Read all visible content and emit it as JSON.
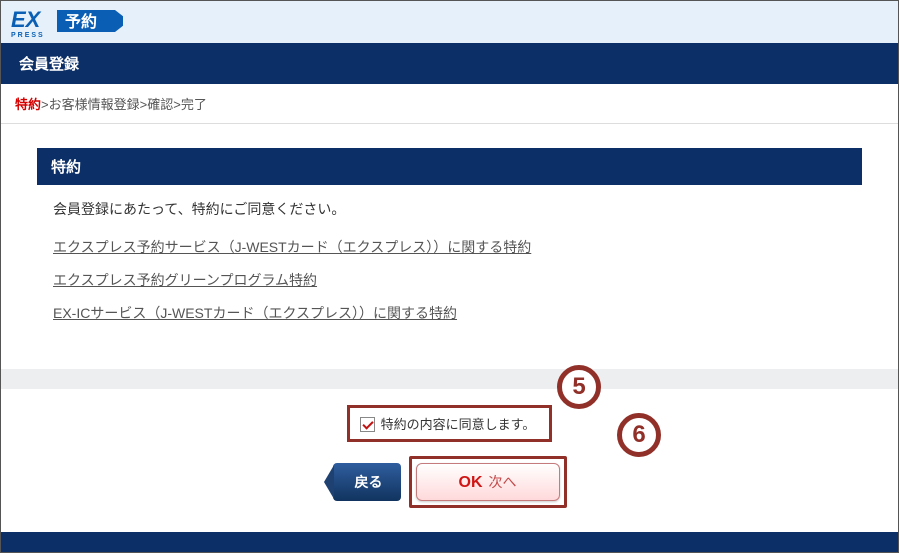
{
  "logo": {
    "ex_text": "EX",
    "press_text": "PRESS",
    "yoyaku_text": "予約"
  },
  "header": {
    "title": "会員登録"
  },
  "breadcrumb": {
    "current": "特約",
    "steps": [
      "お客様情報登録",
      "確認",
      "完了"
    ]
  },
  "section": {
    "title": "特約",
    "intro": "会員登録にあたって、特約にご同意ください。",
    "links": [
      "エクスプレス予約サービス（J-WESTカード（エクスプレス））に関する特約",
      "エクスプレス予約グリーンプログラム特約",
      "EX-ICサービス（J-WESTカード（エクスプレス））に関する特約"
    ]
  },
  "agree": {
    "label": "特約の内容に同意します。"
  },
  "buttons": {
    "back": "戻る",
    "ok": "OK",
    "next": "次へ"
  },
  "callouts": {
    "five": "5",
    "six": "6"
  }
}
